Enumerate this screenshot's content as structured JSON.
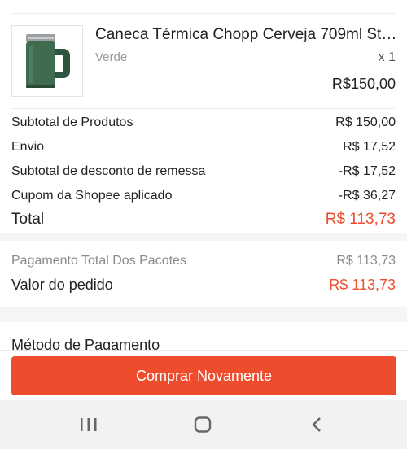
{
  "product": {
    "title": "Caneca Térmica Chopp Cerveja 709ml Stan...",
    "variant": "Verde",
    "quantity": "x 1",
    "price": "R$150,00",
    "thumbnail_icon": "green-thermal-mug"
  },
  "summary": [
    {
      "label": "Subtotal de Produtos",
      "value": "R$ 150,00"
    },
    {
      "label": "Envio",
      "value": "R$ 17,52"
    },
    {
      "label": "Subtotal de desconto de remessa",
      "value": "-R$ 17,52"
    },
    {
      "label": "Cupom da Shopee aplicado",
      "value": "-R$ 36,27"
    }
  ],
  "total": {
    "label": "Total",
    "value": "R$ 113,73"
  },
  "payment": {
    "packages_label": "Pagamento Total Dos Pacotes",
    "packages_value": "R$ 113,73",
    "order_label": "Valor do pedido",
    "order_value": "R$ 113,73"
  },
  "payment_method": {
    "title": "Método de Pagamento"
  },
  "actions": {
    "buy_again": "Comprar Novamente"
  },
  "navbar": {
    "icons": [
      "recent-apps-icon",
      "home-icon",
      "back-icon"
    ]
  },
  "colors": {
    "accent": "#ee4d2d",
    "muted": "#8a8a8a",
    "mug": "#3f6b4f"
  }
}
